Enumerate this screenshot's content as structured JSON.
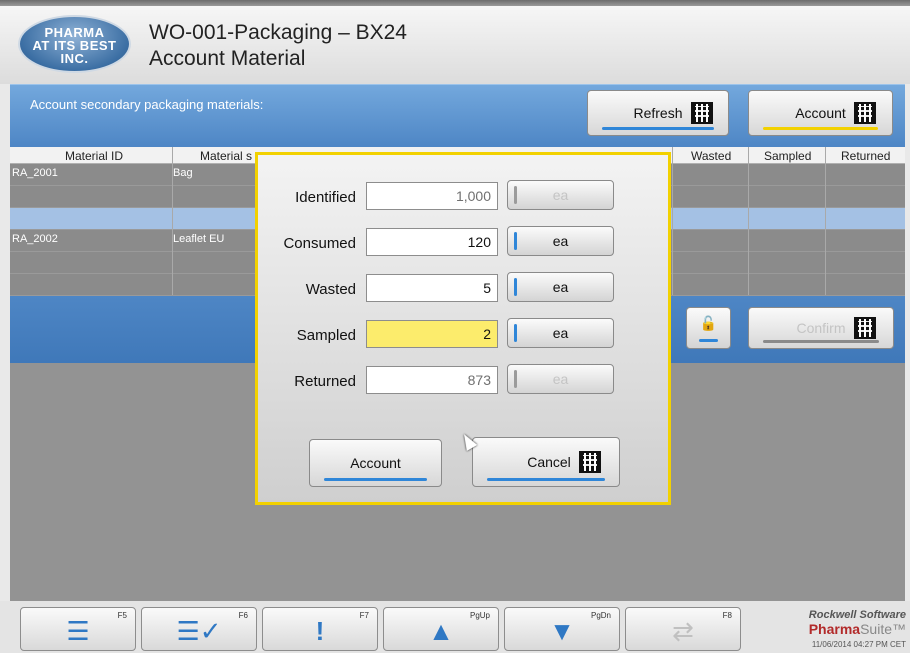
{
  "header": {
    "logo_line1": "PHARMA",
    "logo_line2": "AT ITS BEST",
    "logo_line3": "INC.",
    "work_order": "WO-001-Packaging  –  BX24",
    "title": "Account Material"
  },
  "section": {
    "label": "Account secondary packaging materials:",
    "refresh_label": "Refresh",
    "account_label": "Account",
    "confirm_label": "Confirm"
  },
  "table": {
    "columns": [
      "Material ID",
      "Material s",
      "Wasted",
      "Sampled",
      "Returned"
    ],
    "rows": [
      {
        "material_id": "RA_2001",
        "material": "Bag"
      },
      {
        "material_id": "",
        "material": ""
      },
      {
        "material_id": "",
        "material": ""
      },
      {
        "material_id": "RA_2002",
        "material": "Leaflet EU"
      },
      {
        "material_id": "",
        "material": ""
      },
      {
        "material_id": "",
        "material": ""
      }
    ]
  },
  "dialog": {
    "fields": [
      {
        "label": "Identified",
        "value": "1,000",
        "unit": "ea"
      },
      {
        "label": "Consumed",
        "value": "120",
        "unit": "ea"
      },
      {
        "label": "Wasted",
        "value": "5",
        "unit": "ea"
      },
      {
        "label": "Sampled",
        "value": "2",
        "unit": "ea"
      },
      {
        "label": "Returned",
        "value": "873",
        "unit": "ea"
      }
    ],
    "account_label": "Account",
    "cancel_label": "Cancel"
  },
  "footer": {
    "keys": [
      "F5",
      "F6",
      "F7",
      "PgUp",
      "PgDn",
      "F8"
    ],
    "brand_line1": "Rockwell Software",
    "brand_pharma": "Pharma",
    "brand_suite": "Suite™",
    "timestamp": "11/06/2014 04:27 PM CET"
  },
  "colors": {
    "accent_blue": "#2f86d8",
    "highlight_yellow": "#fcec6c",
    "dialog_border": "#f2d100"
  }
}
